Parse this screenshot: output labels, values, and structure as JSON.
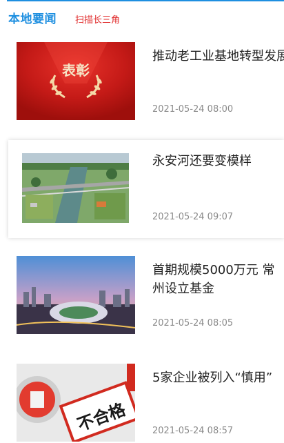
{
  "header": {
    "title": "本地要闻",
    "tag": "扫描长三角"
  },
  "news": [
    {
      "headline": "推动老工业基地转型发展",
      "time": "2021-05-24 08:00",
      "thumb_text": "表彰"
    },
    {
      "headline": "永安河还要变模样",
      "time": "2021-05-24 09:07"
    },
    {
      "headline": "首期规模5000万元 常州设立基金",
      "time": "2021-05-24 08:05"
    },
    {
      "headline": "5家企业被列入“慎用”",
      "time": "2021-05-24 08:57",
      "thumb_text": "不合格"
    }
  ],
  "colors": {
    "accent": "#1e8fe0",
    "tag": "#e02b2b",
    "timestamp": "#8a8a8a"
  }
}
